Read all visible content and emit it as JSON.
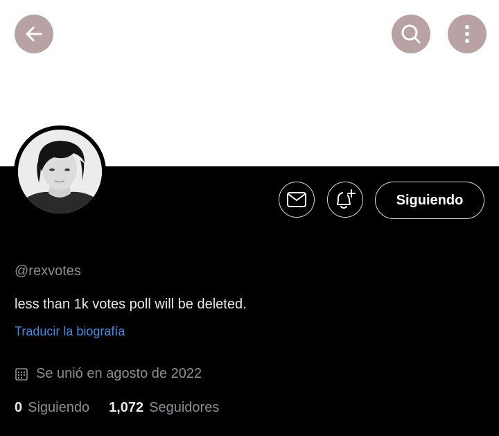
{
  "profile": {
    "handle": "@rexvotes",
    "bio": "less than 1k votes poll will be deleted.",
    "translate_bio": "Traducir la biografía",
    "joined": "Se unió en agosto de 2022",
    "stats": {
      "following_count": "0",
      "following_label": "Siguiendo",
      "followers_count": "1,072",
      "followers_label": "Seguidores"
    }
  },
  "actions": {
    "follow_label": "Siguiendo"
  },
  "icons": {
    "back": "arrow-left-icon",
    "search": "search-icon",
    "more": "more-vertical-icon",
    "mail": "mail-icon",
    "bell": "bell-plus-icon",
    "calendar": "calendar-icon"
  },
  "colors": {
    "header_button_bg": "#b9a2a3",
    "banner_bg": "#ffffff",
    "page_bg": "#000000",
    "link": "#3e8fe6",
    "muted_text": "#8b8f94",
    "primary_text": "#e7e9ea"
  }
}
